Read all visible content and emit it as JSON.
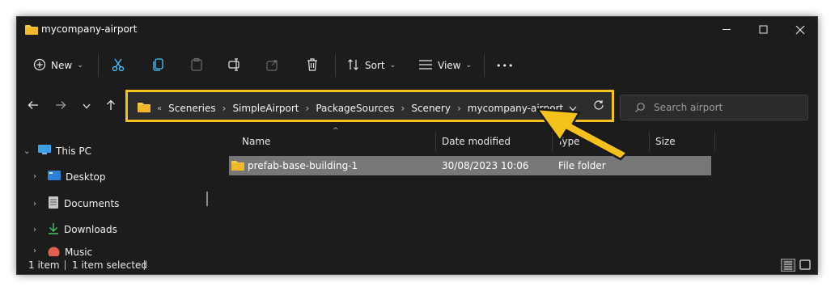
{
  "window": {
    "title": "mycompany-airport"
  },
  "commands": {
    "new_label": "New",
    "sort_label": "Sort",
    "view_label": "View",
    "more_label": "•••"
  },
  "address": {
    "overflow": "«",
    "crumbs": [
      "Sceneries",
      "SimpleAirport",
      "PackageSources",
      "Scenery",
      "mycompany-airport"
    ]
  },
  "search": {
    "placeholder": "Search airport"
  },
  "sidebar": {
    "items": [
      {
        "label": "This PC"
      },
      {
        "label": "Desktop"
      },
      {
        "label": "Documents"
      },
      {
        "label": "Downloads"
      },
      {
        "label": "Music"
      }
    ]
  },
  "columns": {
    "name": "Name",
    "date": "Date modified",
    "type": "Type",
    "size": "Size"
  },
  "files": [
    {
      "name": "prefab-base-building-1",
      "date": "30/08/2023 10:06",
      "type": "File folder",
      "size": ""
    }
  ],
  "status": {
    "count": "1 item",
    "selected": "1 item selected"
  },
  "colors": {
    "accent_outline": "#f4c21a",
    "folder_yellow": "#f7c948",
    "selection": "#777777"
  }
}
